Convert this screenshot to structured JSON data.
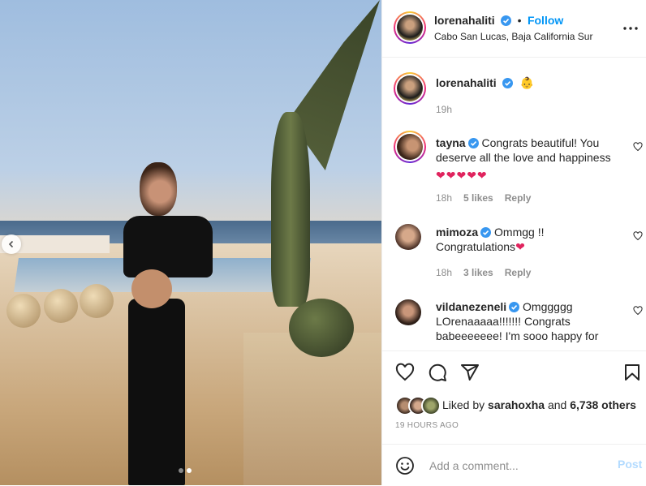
{
  "post": {
    "author": "lorenahaliti",
    "follow_label": "Follow",
    "location": "Cabo San Lucas, Baja California Sur",
    "caption_emoji": "👶",
    "caption_time": "19h",
    "carousel": {
      "current_slide": 2,
      "total_slides": 2
    }
  },
  "comments": [
    {
      "user": "tayna",
      "text": "Congrats beautiful! You deserve all the love and happiness",
      "emoji": "❤❤❤❤❤",
      "time": "18h",
      "likes": "5 likes",
      "reply": "Reply"
    },
    {
      "user": "mimoza",
      "text": "Ommgg !!",
      "text2": "Congratulations",
      "emoji": "❤",
      "time": "18h",
      "likes": "3 likes",
      "reply": "Reply"
    },
    {
      "user": "vildanezeneli",
      "text": "Omggggg",
      "text2": "LOrenaaaaa!!!!!!! Congrats",
      "text3": "babeeeeeee! I'm sooo happy for"
    }
  ],
  "likes": {
    "prefix": "Liked by",
    "user": "sarahoxha",
    "and": "and",
    "count": "6,738 others"
  },
  "timestamp": "19 HOURS AGO",
  "compose": {
    "placeholder": "Add a comment...",
    "post_label": "Post"
  },
  "colors": {
    "accent": "#0095f6",
    "verified": "#3897f0",
    "heart": "#e0245e"
  },
  "icons": [
    "chevron-left-icon",
    "more-icon",
    "heart-icon",
    "comment-icon",
    "share-icon",
    "bookmark-icon",
    "emoji-icon"
  ]
}
